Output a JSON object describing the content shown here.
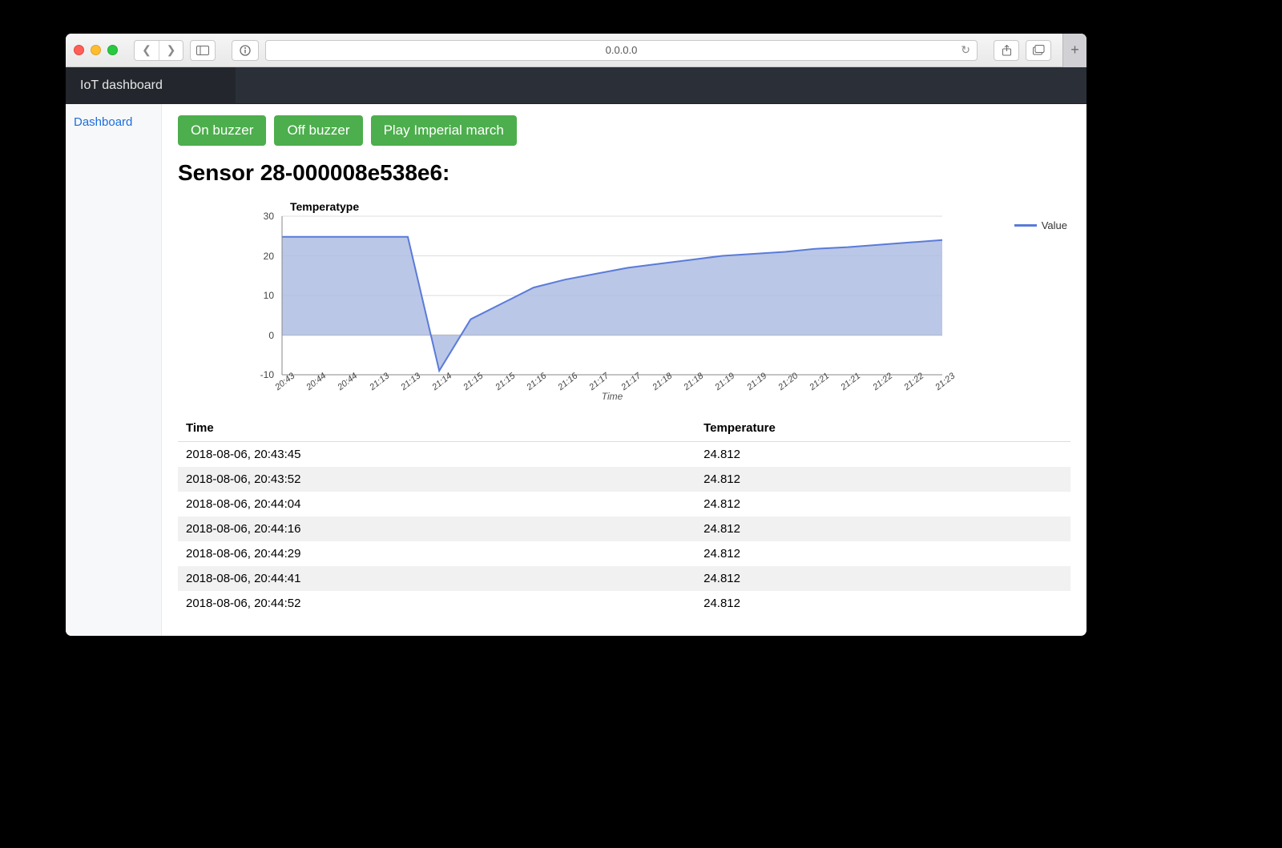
{
  "browser": {
    "address": "0.0.0.0"
  },
  "app": {
    "header_title": "IoT dashboard",
    "sidebar": {
      "items": [
        {
          "label": "Dashboard"
        }
      ]
    }
  },
  "buttons": {
    "on_buzzer": "On buzzer",
    "off_buzzer": "Off buzzer",
    "play_march": "Play Imperial march"
  },
  "sensor": {
    "title": "Sensor 28-000008e538e6:"
  },
  "chart_data": {
    "type": "area",
    "title": "Temperatype",
    "xlabel": "Time",
    "ylabel": "",
    "ylim": [
      -10,
      30
    ],
    "y_ticks": [
      -10,
      0,
      10,
      20,
      30
    ],
    "legend": {
      "series_name": "Value"
    },
    "x_ticks": [
      "20:43",
      "20:44",
      "20:44",
      "21:13",
      "21:13",
      "21:14",
      "21:15",
      "21:15",
      "21:16",
      "21:16",
      "21:17",
      "21:17",
      "21:18",
      "21:18",
      "21:19",
      "21:19",
      "21:20",
      "21:21",
      "21:21",
      "21:22",
      "21:22",
      "21:23"
    ],
    "series": [
      {
        "name": "Value",
        "x": [
          "20:43",
          "20:44",
          "20:44",
          "21:13",
          "21:13",
          "21:14",
          "21:15",
          "21:15",
          "21:16",
          "21:16",
          "21:17",
          "21:17",
          "21:18",
          "21:18",
          "21:19",
          "21:19",
          "21:20",
          "21:21",
          "21:21",
          "21:22",
          "21:22",
          "21:23"
        ],
        "values": [
          24.8,
          24.8,
          24.8,
          24.8,
          24.8,
          -9,
          4,
          8,
          12,
          14,
          15.5,
          17,
          18,
          19,
          20,
          20.5,
          21,
          21.8,
          22.2,
          22.8,
          23.4,
          24
        ]
      }
    ]
  },
  "table": {
    "headers": {
      "time": "Time",
      "temperature": "Temperature"
    },
    "rows": [
      {
        "time": "2018-08-06, 20:43:45",
        "temp": "24.812"
      },
      {
        "time": "2018-08-06, 20:43:52",
        "temp": "24.812"
      },
      {
        "time": "2018-08-06, 20:44:04",
        "temp": "24.812"
      },
      {
        "time": "2018-08-06, 20:44:16",
        "temp": "24.812"
      },
      {
        "time": "2018-08-06, 20:44:29",
        "temp": "24.812"
      },
      {
        "time": "2018-08-06, 20:44:41",
        "temp": "24.812"
      },
      {
        "time": "2018-08-06, 20:44:52",
        "temp": "24.812"
      }
    ]
  }
}
